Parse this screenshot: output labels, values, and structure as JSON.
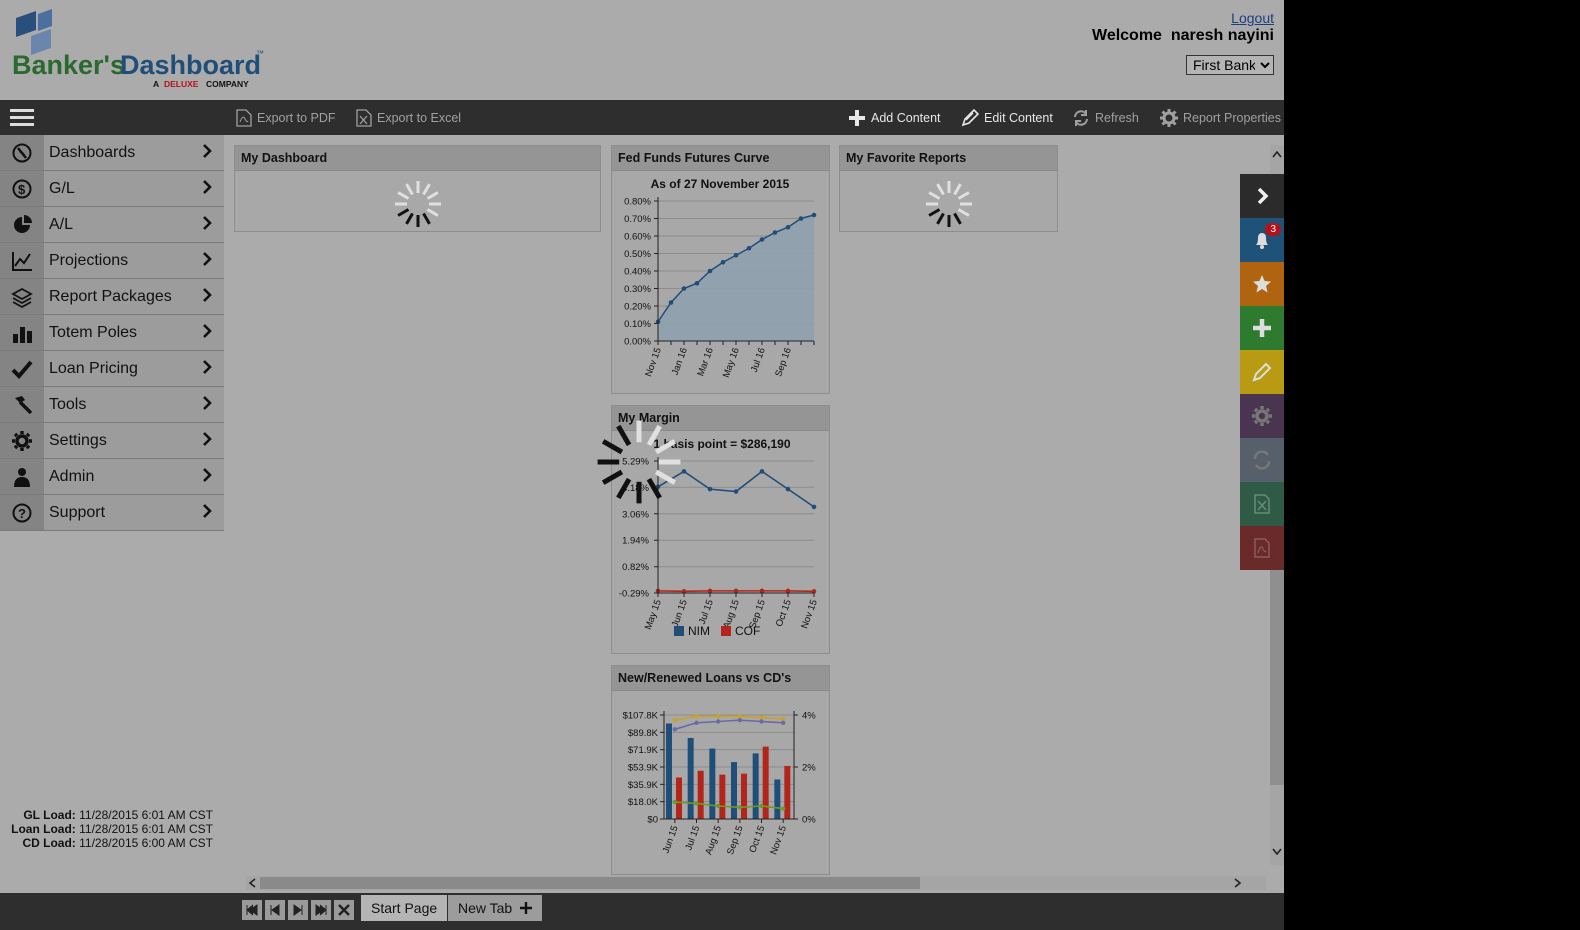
{
  "header": {
    "logo_text_bankers": "Banker's",
    "logo_text_dashboard": "Dashboard",
    "logo_tm": "™",
    "logo_tagline_a": "A",
    "logo_tagline_deluxe": "DELUXE",
    "logo_tagline_company": "COMPANY",
    "logout_label": "Logout",
    "welcome_label": "Welcome",
    "user_name": "naresh nayini",
    "bank_selected": "First Bank"
  },
  "toolbar": {
    "export_pdf": "Export to PDF",
    "export_excel": "Export to Excel",
    "add_content": "Add Content",
    "edit_content": "Edit Content",
    "refresh": "Refresh",
    "report_properties": "Report Properties"
  },
  "sidebar": {
    "items": [
      {
        "label": "Dashboards",
        "icon": "compass-icon"
      },
      {
        "label": "G/L",
        "icon": "dollar-icon"
      },
      {
        "label": "A/L",
        "icon": "pie-icon"
      },
      {
        "label": "Projections",
        "icon": "line-chart-icon"
      },
      {
        "label": "Report Packages",
        "icon": "layers-icon"
      },
      {
        "label": "Totem Poles",
        "icon": "bar-chart-icon"
      },
      {
        "label": "Loan Pricing",
        "icon": "check-icon"
      },
      {
        "label": "Tools",
        "icon": "hammer-icon"
      },
      {
        "label": "Settings",
        "icon": "gear-icon"
      },
      {
        "label": "Admin",
        "icon": "person-icon"
      },
      {
        "label": "Support",
        "icon": "question-icon"
      }
    ],
    "load": {
      "gl_label": "GL Load:",
      "gl_value": "11/28/2015 6:01 AM CST",
      "loan_label": "Loan Load:",
      "loan_value": "11/28/2015 6:01 AM CST",
      "cd_label": "CD Load:",
      "cd_value": "11/28/2015 6:00 AM CST"
    }
  },
  "panels": {
    "my_dashboard": "My Dashboard",
    "fed_funds": "Fed Funds Futures Curve",
    "favorite_reports": "My Favorite Reports",
    "my_margin": "My Margin",
    "loans_vs_cds": "New/Renewed Loans vs CD's"
  },
  "rightbar": {
    "notification_count": "3",
    "colors": [
      "#2b2b2b",
      "#1e5278",
      "#b06410",
      "#2e7a2e",
      "#b89b12",
      "#4a3550",
      "#55606a",
      "#2f5a45",
      "#6a2a2a"
    ]
  },
  "bottombar": {
    "tab_start": "Start Page",
    "tab_new": "New Tab"
  },
  "chart_data": [
    {
      "type": "area",
      "title": "As of 27 November 2015",
      "x": [
        "Nov 15",
        "Dec 15",
        "Jan 16",
        "Feb 16",
        "Mar 16",
        "Apr 16",
        "May 16",
        "Jun 16",
        "Jul 16",
        "Aug 16",
        "Sep 16",
        "Oct 16",
        "Nov 16"
      ],
      "x_tick_labels": [
        "Nov 15",
        "Jan 16",
        "Mar 16",
        "May 16",
        "Jul 16",
        "Sep 16"
      ],
      "y_tick_labels": [
        "0.00%",
        "0.10%",
        "0.20%",
        "0.30%",
        "0.40%",
        "0.50%",
        "0.60%",
        "0.70%",
        "0.80%"
      ],
      "values": [
        0.11,
        0.22,
        0.3,
        0.33,
        0.4,
        0.45,
        0.49,
        0.53,
        0.58,
        0.62,
        0.65,
        0.7,
        0.72
      ],
      "ylim": [
        0,
        0.8
      ],
      "color": "#1f4e79",
      "fill": "#8fa0ae"
    },
    {
      "type": "line",
      "title": "1 basis point = $286,190",
      "x": [
        "May 15",
        "Jun 15",
        "Jul 15",
        "Aug 15",
        "Sep 15",
        "Oct 15",
        "Nov 15"
      ],
      "y_tick_labels": [
        "-0.29%",
        "0.82%",
        "1.94%",
        "3.06%",
        "4.18%",
        "5.29%"
      ],
      "y_ticks": [
        -0.29,
        0.82,
        1.94,
        3.06,
        4.18,
        5.29
      ],
      "ylim": [
        -0.29,
        5.29
      ],
      "legend": "bottom",
      "series": [
        {
          "name": "NIM",
          "color": "#1f4e79",
          "values": [
            4.2,
            4.85,
            4.1,
            4.0,
            4.85,
            4.1,
            3.35
          ]
        },
        {
          "name": "COF",
          "color": "#b3241b",
          "values": [
            -0.2,
            -0.22,
            -0.2,
            -0.2,
            -0.2,
            -0.2,
            -0.22
          ]
        }
      ]
    },
    {
      "type": "bar",
      "categories": [
        "Jun 15",
        "Jul 15",
        "Aug 15",
        "Sep 15",
        "Oct 15",
        "Nov 15"
      ],
      "y_tick_labels": [
        "$0",
        "$18.0K",
        "$35.9K",
        "$53.9K",
        "$71.9K",
        "$89.8K",
        "$107.8K"
      ],
      "y2_tick_labels": [
        "0%",
        "2%",
        "4%"
      ],
      "ylim": [
        0,
        107.8
      ],
      "y2lim": [
        0,
        4
      ],
      "series": [
        {
          "type": "bar",
          "color": "#1f4e79",
          "values": [
            99,
            84,
            73,
            59,
            68,
            41
          ]
        },
        {
          "type": "bar",
          "color": "#b3241b",
          "values": [
            43,
            50,
            46,
            47,
            75,
            55
          ]
        },
        {
          "type": "line",
          "axis": "right",
          "color": "#c9a227",
          "values": [
            3.8,
            3.95,
            3.95,
            3.95,
            3.9,
            3.85
          ]
        },
        {
          "type": "line",
          "axis": "right",
          "color": "#6b6aa8",
          "values": [
            3.45,
            3.7,
            3.75,
            3.8,
            3.75,
            3.7
          ]
        },
        {
          "type": "line",
          "axis": "right",
          "color": "#6c9a2a",
          "values": [
            0.65,
            0.6,
            0.5,
            0.45,
            0.5,
            0.4
          ]
        }
      ]
    }
  ]
}
